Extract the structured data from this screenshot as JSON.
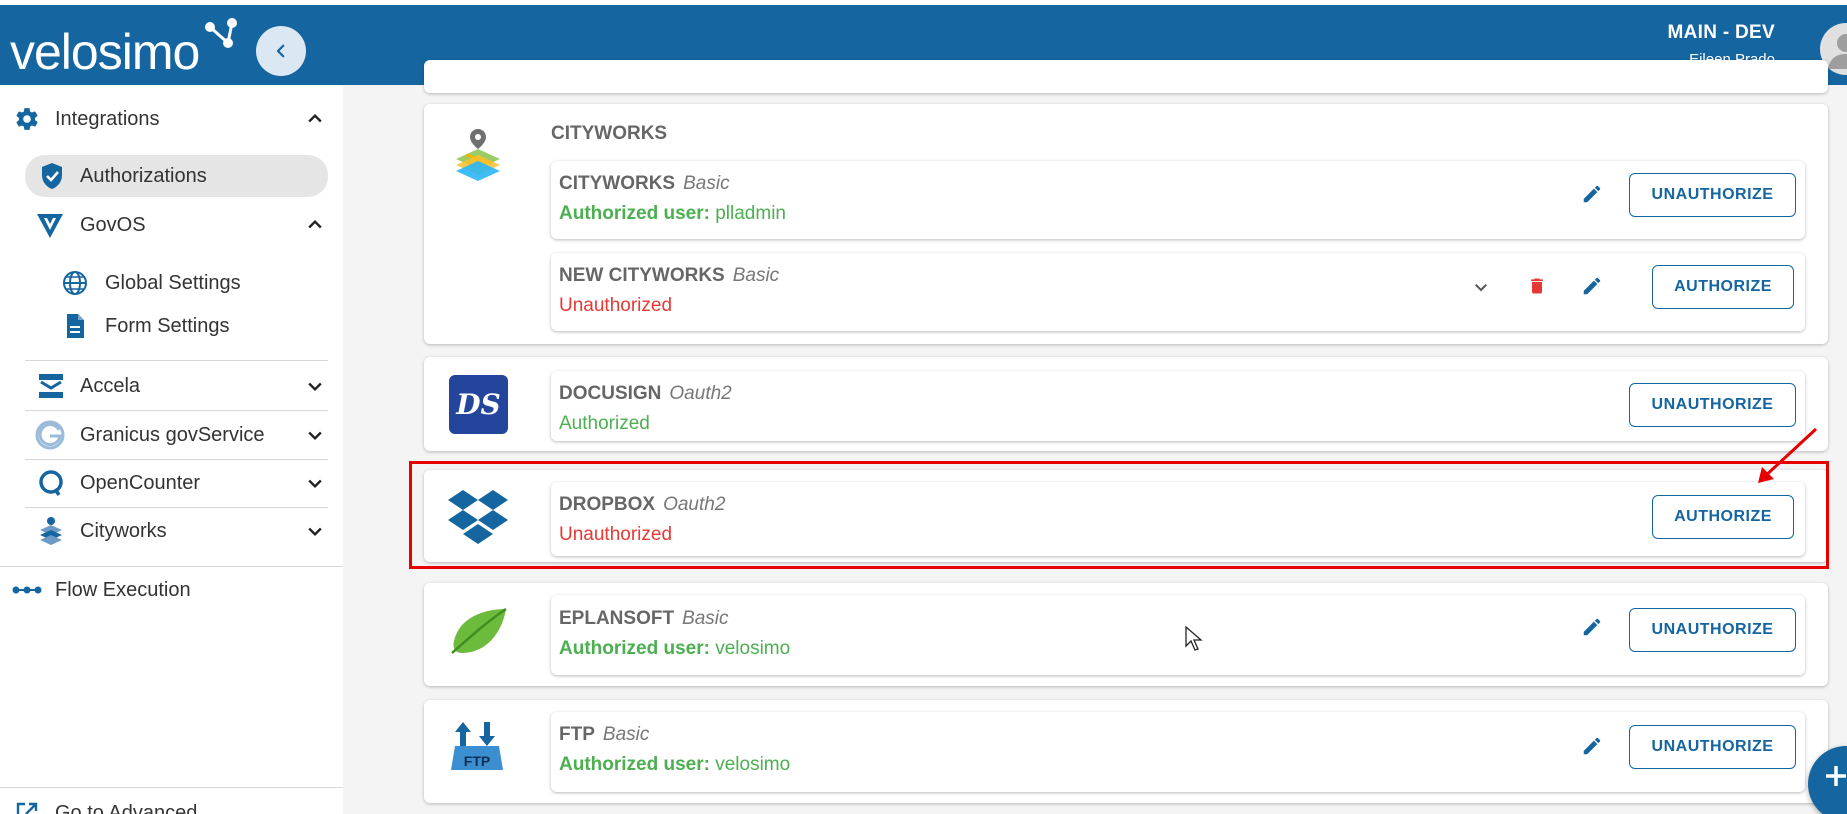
{
  "header": {
    "logo_text": "velosimo",
    "environment": "MAIN - DEV",
    "user_name": "Eileen Prado"
  },
  "sidebar": {
    "integrations": "Integrations",
    "authorizations": "Authorizations",
    "govos": "GovOS",
    "global_settings": "Global Settings",
    "form_settings": "Form Settings",
    "accela": "Accela",
    "granicus": "Granicus govService",
    "opencounter": "OpenCounter",
    "cityworks": "Cityworks",
    "flow_execution": "Flow Execution",
    "go_advanced": "Go to Advanced"
  },
  "groups": {
    "cityworks_title": "CITYWORKS"
  },
  "integrations": [
    {
      "name": "CITYWORKS",
      "type": "Basic",
      "status_label": "Authorized user:",
      "status_value": "plladmin",
      "button": "UNAUTHORIZE"
    },
    {
      "name": "NEW CITYWORKS",
      "type": "Basic",
      "status_label": "",
      "status_value": "Unauthorized",
      "button": "AUTHORIZE"
    },
    {
      "name": "DOCUSIGN",
      "type": "Oauth2",
      "status_label": "",
      "status_value": "Authorized",
      "button": "UNAUTHORIZE"
    },
    {
      "name": "DROPBOX",
      "type": "Oauth2",
      "status_label": "",
      "status_value": "Unauthorized",
      "button": "AUTHORIZE"
    },
    {
      "name": "EPLANSOFT",
      "type": "Basic",
      "status_label": "Authorized user:",
      "status_value": "velosimo",
      "button": "UNAUTHORIZE"
    },
    {
      "name": "FTP",
      "type": "Basic",
      "status_label": "Authorized user:",
      "status_value": "velosimo",
      "button": "UNAUTHORIZE"
    }
  ],
  "icons": {
    "ftp_logo_text": "FTP",
    "docusign_logo_text": "DS"
  },
  "colors": {
    "brand": "#1565a0",
    "authorized": "#4caf50",
    "unauthorized": "#e53935",
    "highlight": "#e60000"
  }
}
